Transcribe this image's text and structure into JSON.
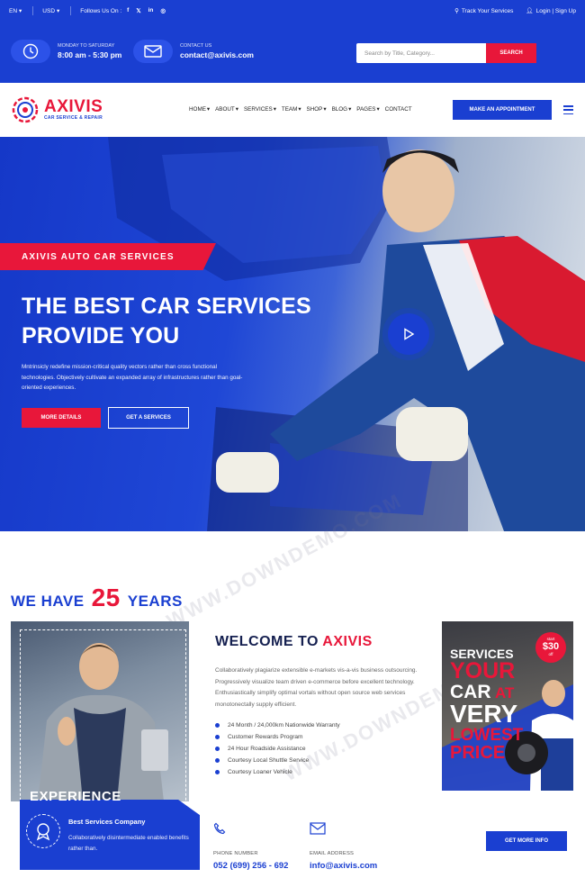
{
  "topbar": {
    "language": "EN",
    "currency": "USD",
    "follow_label": "Follows Us On :",
    "social": [
      "f",
      "𝕏",
      "in",
      "◎"
    ],
    "track": "Track Your Services",
    "login": "Login | Sign Up"
  },
  "info": {
    "hours_label": "MONDAY TO SATURDAY",
    "hours_value": "8:00 am - 5:30 pm",
    "contact_label": "CONTACT US",
    "contact_value": "contact@axivis.com",
    "search_placeholder": "Search by Title, Category...",
    "search_button": "SEARCH"
  },
  "nav": {
    "logo_name": "AXIVIS",
    "logo_sub": "CAR SERVICE & REPAIR",
    "menu": [
      "HOME",
      "ABOUT",
      "SERVICES",
      "TEAM",
      "SHOP",
      "BLOG",
      "PAGES",
      "CONTACT"
    ],
    "appointment": "MAKE AN APPOINTMENT"
  },
  "hero": {
    "tag": "AXIVIS AUTO CAR SERVICES",
    "title_line1": "THE BEST CAR SERVICES",
    "title_line2": "PROVIDE YOU",
    "description": "Mntrinsicly redefine mission-critical quality vectors rather than cross functional technologies. Objectively cultivate an expanded array of infrastructures rather than goal-oriented experiences.",
    "button_primary": "MORE DETAILS",
    "button_secondary": "GET A SERVICES"
  },
  "about": {
    "years_prefix": "WE HAVE",
    "years_number": "25",
    "years_suffix": "YEARS",
    "experience_word": "EXPERIENCE",
    "card_title": "Best Services Company",
    "card_desc": "Collaboratively disintermediate enabled benefits rather than.",
    "welcome_prefix": "WELCOME TO",
    "welcome_brand": "AXIVIS",
    "welcome_desc": "Collaboratively plagiarize extensible e-markets vis-a-vis business outsourcing. Progressively visualize team driven e-commerce before excellent technology. Enthusiastically simplify optimal vortals without open source web services monotonectally supply efficient.",
    "features": [
      "24 Month / 24,000km Nationwide Warranty",
      "Customer Rewards Program",
      "24 Hour Roadside Assistance",
      "Courtesy Local Shuttle Service",
      "Courtesy Loaner Vehicle"
    ],
    "phone_label": "PHONE NUMBER",
    "phone_value": "052 (699) 256 - 692",
    "email_label": "EMAIL ADDRESS",
    "email_value": "info@axivis.com",
    "more_button": "GET MORE INFO"
  },
  "promo": {
    "line1": "SERVICES",
    "line2a": "YOUR",
    "line3a": "CAR",
    "line3b": "AT",
    "line4": "VERY",
    "line5": "LOWEST",
    "line6": "PRICE",
    "badge_start": "start",
    "badge_price": "$30",
    "badge_off": "off"
  },
  "watermark": "WWW.DOWNDEMO.COM",
  "colors": {
    "primary": "#1a3fd1",
    "accent": "#e8173a",
    "dark": "#152050"
  }
}
